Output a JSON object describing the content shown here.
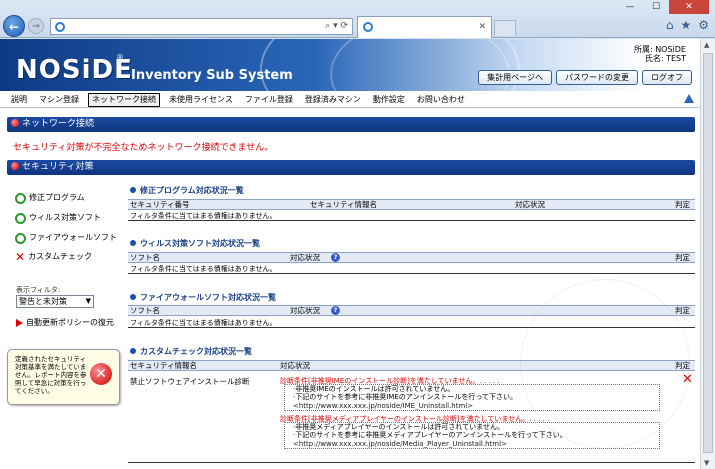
{
  "browser": {
    "win_minimize": "—",
    "win_maximize": "☐",
    "win_close": "✕",
    "back_glyph": "←",
    "forward_glyph": "→",
    "search_glyph": "⌕ ▾ ⟳",
    "tab_close": "✕",
    "home_icon": "⌂",
    "favorites_icon": "★",
    "settings_icon": "⚙"
  },
  "header": {
    "logo": "NOSiDE",
    "logo_mark": "®",
    "subtitle": "Inventory Sub System",
    "user_line1": "所属: NOSiDE",
    "user_line2": "氏名: TEST",
    "buttons": [
      "集計用ページへ",
      "パスワードの変更",
      "ログオフ"
    ]
  },
  "menu": {
    "items": [
      "説明",
      "マシン登録",
      "ネットワーク接続",
      "未使用ライセンス",
      "ファイル登録",
      "登録済みマシン",
      "動作設定",
      "お問い合わせ"
    ],
    "active_index": 2
  },
  "network": {
    "bar_title": "ネットワーク接続",
    "error": "セキュリティ対策が不完全なためネットワーク接続できません。"
  },
  "security": {
    "bar_title": "セキュリティ対策"
  },
  "sidebar": {
    "items": [
      {
        "label": "修正プログラム",
        "status": "ok"
      },
      {
        "label": "ウィルス対策ソフト",
        "status": "ok"
      },
      {
        "label": "ファイアウォールソフト",
        "status": "ok"
      },
      {
        "label": "カスタムチェック",
        "status": "ng"
      }
    ],
    "filter_label": "表示フィルタ:",
    "filter_value": "警告と未対策",
    "policy_link": "自動更新ポリシーの復元",
    "warning": "定義されたセキュリティ対策基準を満たしていません。レポート内容を参照して早急に対策を行ってください。",
    "warning_glyph": "✕"
  },
  "sections": {
    "patch": {
      "title": "修正プログラム対応状況一覧",
      "headers": [
        "セキュリティ番号",
        "セキュリティ情報名",
        "対応状況",
        "判定"
      ],
      "empty": "フィルタ条件に当てはまる債権はありません。"
    },
    "antivirus": {
      "title": "ウィルス対策ソフト対応状況一覧",
      "headers": [
        "ソフト名",
        "対応状況",
        "判定"
      ],
      "empty": "フィルタ条件に当てはまる債権はありません。"
    },
    "firewall": {
      "title": "ファイアウォールソフト対応状況一覧",
      "headers": [
        "ソフト名",
        "対応状況",
        "判定"
      ],
      "empty": "フィルタ条件に当てはまる債権はありません。"
    },
    "custom": {
      "title": "カスタムチェック対応状況一覧",
      "headers": [
        "セキュリティ情報名",
        "対応状況",
        "判定"
      ],
      "row_name": "禁止ソフトウェアインストール診断",
      "cond1_title": "診断条件[非推奨IMEのインストール診断]を満たしていません。. . . . .",
      "cond1_lines": [
        "·非推奨IMEのインストールは許可されていません。",
        "·下記のサイトを参考に非推奨IMEのアンインストールを行って下さい。",
        "<http://www.xxx.xxx.jp/noside/IME_Uninstall.html>"
      ],
      "cond2_title": "診断条件[非推奨メディアプレイヤーのインストール診断]を満たしていません。. . . . .",
      "cond2_lines": [
        "·非推奨メディアプレイヤーのインストールは許可されていません。",
        "·下記のサイトを参考に非推奨メディアプレイヤーのアンインストールを行って下さい。",
        "<http://www.xxx.xxx.jp/noside/Media_Player_Uninstall.html>"
      ],
      "result_glyph": "✕"
    },
    "help_glyph": "?"
  }
}
